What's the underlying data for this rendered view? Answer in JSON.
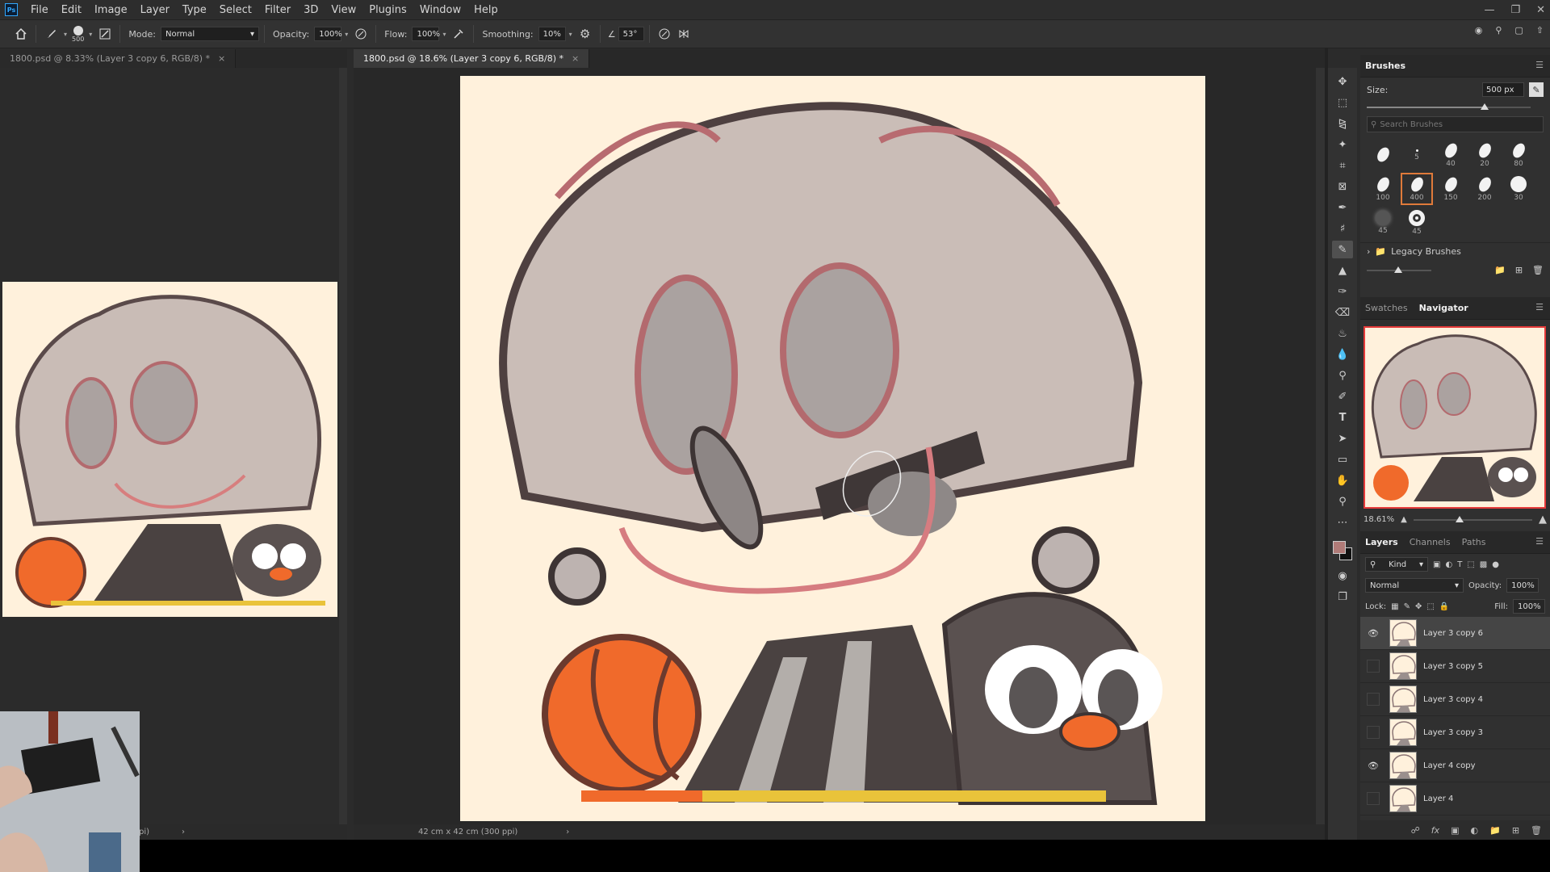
{
  "app": {
    "logo": "Ps"
  },
  "menu": [
    "File",
    "Edit",
    "Image",
    "Layer",
    "Type",
    "Select",
    "Filter",
    "3D",
    "View",
    "Plugins",
    "Window",
    "Help"
  ],
  "options": {
    "brush_size": "500",
    "mode_label": "Mode:",
    "mode_value": "Normal",
    "opacity_label": "Opacity:",
    "opacity_value": "100%",
    "flow_label": "Flow:",
    "flow_value": "100%",
    "smoothing_label": "Smoothing:",
    "smoothing_value": "10%",
    "angle_value": "53°"
  },
  "tabs": [
    {
      "label": "1800.psd @ 8.33% (Layer 3 copy 6, RGB/8) *",
      "active": false
    },
    {
      "label": "1800.psd @ 18.6% (Layer 3 copy 6, RGB/8) *",
      "active": true
    }
  ],
  "status": {
    "left": "pi)",
    "main": "42 cm x 42 cm (300 ppi)"
  },
  "brushes_panel": {
    "title": "Brushes",
    "size_label": "Size:",
    "size_value": "500 px",
    "size_fraction": 0.72,
    "search_placeholder": "Search Brushes",
    "presets": [
      {
        "label": "",
        "kind": "soft"
      },
      {
        "label": "5",
        "kind": "dot"
      },
      {
        "label": "40",
        "kind": "hard"
      },
      {
        "label": "20",
        "kind": "hard"
      },
      {
        "label": "80",
        "kind": "hard"
      },
      {
        "label": "100",
        "kind": "hard"
      },
      {
        "label": "400",
        "kind": "hard",
        "selected": true
      },
      {
        "label": "150",
        "kind": "hard"
      },
      {
        "label": "200",
        "kind": "hard"
      },
      {
        "label": "30",
        "kind": "round"
      },
      {
        "label": "45",
        "kind": "fuzzy"
      },
      {
        "label": "45",
        "kind": "ring"
      }
    ],
    "legacy_label": "Legacy Brushes"
  },
  "navigator_panel": {
    "tabs": [
      "Swatches",
      "Navigator"
    ],
    "active_tab": "Navigator",
    "zoom": "18.61%"
  },
  "layers_panel": {
    "tabs": [
      "Layers",
      "Channels",
      "Paths"
    ],
    "active_tab": "Layers",
    "filter_kind": "Kind",
    "blend_mode": "Normal",
    "opacity_label": "Opacity:",
    "opacity_value": "100%",
    "lock_label": "Lock:",
    "fill_label": "Fill:",
    "fill_value": "100%",
    "layers": [
      {
        "name": "Layer 3 copy 6",
        "visible": true,
        "selected": true
      },
      {
        "name": "Layer 3 copy 5",
        "visible": false,
        "selected": false
      },
      {
        "name": "Layer 3 copy 4",
        "visible": false,
        "selected": false
      },
      {
        "name": "Layer 3 copy 3",
        "visible": false,
        "selected": false
      },
      {
        "name": "Layer 4 copy",
        "visible": true,
        "selected": false
      },
      {
        "name": "Layer 4",
        "visible": false,
        "selected": false
      }
    ]
  },
  "colors": {
    "foreground": "#b07b78",
    "background": "#111111",
    "canvas": "#fff1dc",
    "accent_selection": "#e07a3a"
  }
}
